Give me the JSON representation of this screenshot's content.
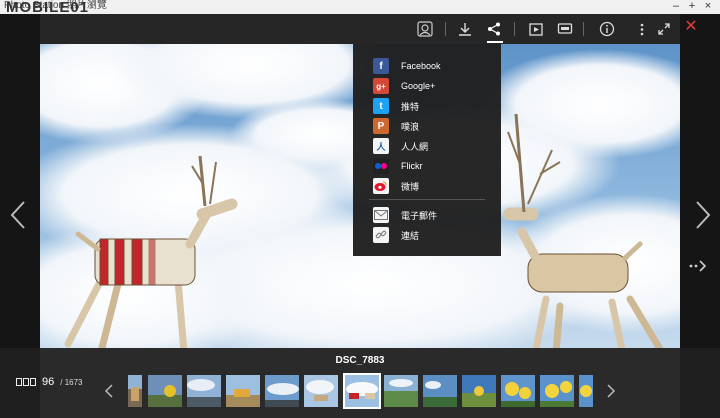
{
  "window": {
    "title": "Photo Station 照片瀏覽",
    "watermark": "MOBILE01",
    "minimize_glyph": "–",
    "maximize_glyph": "+",
    "close_glyph": "×"
  },
  "toolbar": {
    "icons": [
      "face-tag-icon",
      "download-icon",
      "share-icon",
      "slideshow-icon",
      "player-icon",
      "info-icon",
      "more-icon",
      "fullscreen-icon"
    ],
    "close_glyph": "✕"
  },
  "share_menu": {
    "items": [
      {
        "label": "Facebook",
        "icon": "facebook-icon",
        "color": "#3b5998",
        "glyph": "f"
      },
      {
        "label": "Google+",
        "icon": "google-plus-icon",
        "color": "#d34836",
        "glyph": "g+"
      },
      {
        "label": "推特",
        "icon": "twitter-icon",
        "color": "#1da1f2",
        "glyph": "t"
      },
      {
        "label": "噗浪",
        "icon": "plurk-icon",
        "color": "#cf682f",
        "glyph": "P"
      },
      {
        "label": "人人網",
        "icon": "renren-icon",
        "color": "#ffffff",
        "glyph": "人"
      },
      {
        "label": "Flickr",
        "icon": "flickr-icon",
        "color": "#222222",
        "glyph": "●●"
      },
      {
        "label": "微博",
        "icon": "weibo-icon",
        "color": "#ffffff",
        "glyph": "W"
      },
      {
        "label": "電子郵件",
        "icon": "email-icon",
        "color": "#ffffff",
        "glyph": "✉"
      },
      {
        "label": "連結",
        "icon": "link-icon",
        "color": "#ffffff",
        "glyph": "∞"
      }
    ]
  },
  "viewer": {
    "filename": "DSC_7883",
    "current_index": "96",
    "total": "/ 1673"
  },
  "filmstrip": {
    "thumb_count": 12,
    "selected_index": 5
  }
}
